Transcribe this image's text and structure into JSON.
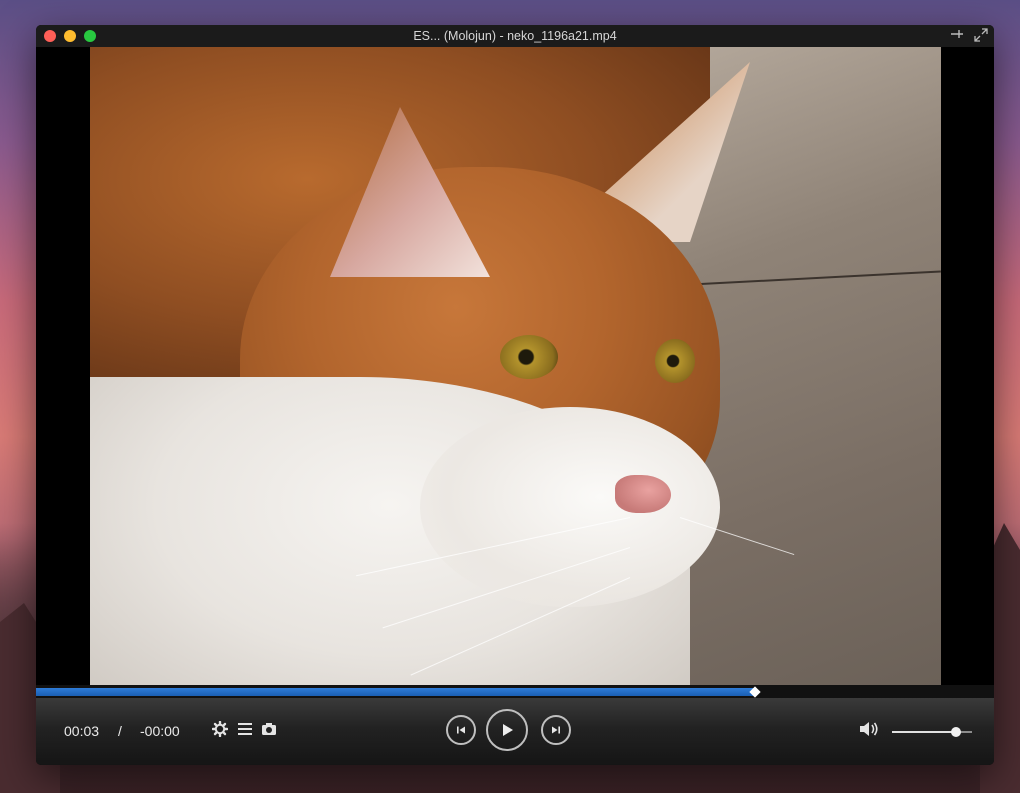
{
  "window": {
    "title": "ES... (Molojun) - neko_1196a21.mp4"
  },
  "player": {
    "current_time": "00:03",
    "time_separator": "/",
    "remaining_time": "-00:00",
    "progress_percent": 75,
    "volume_percent": 80
  },
  "icons": {
    "settings": "gear-icon",
    "playlist": "list-icon",
    "snapshot": "camera-icon",
    "previous": "skip-back-icon",
    "play": "play-icon",
    "next": "skip-forward-icon",
    "volume": "speaker-icon",
    "pin": "pin-icon",
    "fullscreen": "fullscreen-icon"
  },
  "colors": {
    "progress": "#1a5fb4",
    "close": "#fe5f57",
    "minimize": "#febc2e",
    "zoom": "#28c840"
  }
}
